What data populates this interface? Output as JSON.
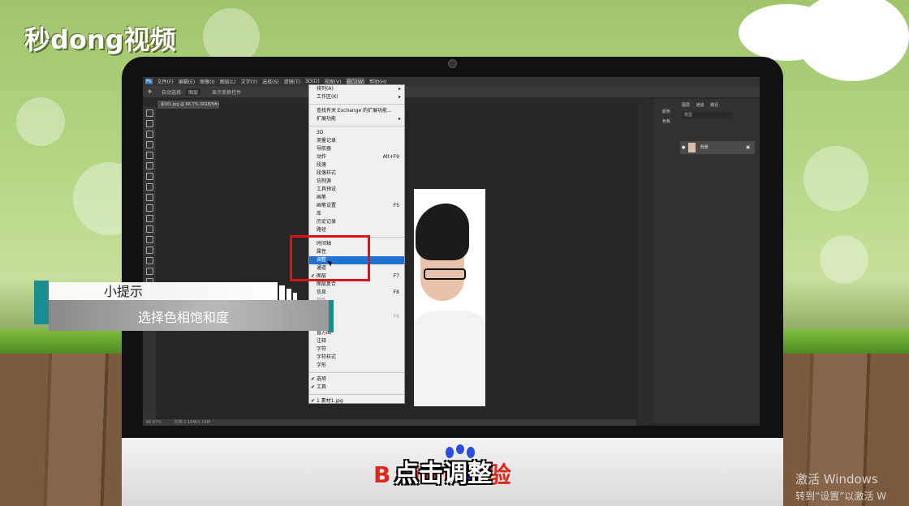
{
  "brand": {
    "logo_text": "秒dong视频"
  },
  "photoshop": {
    "menubar": [
      "文件(F)",
      "编辑(E)",
      "图像(I)",
      "图层(L)",
      "文字(Y)",
      "选择(S)",
      "滤镜(T)",
      "3D(D)",
      "视图(V)",
      "窗口(W)",
      "帮助(H)"
    ],
    "options": {
      "auto_select": "自动选择:",
      "auto_select_value": "图层",
      "transform": "显示变换控件"
    },
    "document_tab": "素材1.jpg @ 66.7% (RGB/8#)",
    "status": {
      "zoom": "66.67%",
      "doc_info": "文档:1.16M/1.16M"
    },
    "panels": {
      "side_labels": [
        "颜色",
        "色板"
      ],
      "tabs": [
        "图层",
        "通道",
        "路径"
      ],
      "search_placeholder": "类型",
      "layer_name": "背景"
    }
  },
  "window_menu": {
    "items": [
      {
        "label": "排列(A)",
        "arrow": true
      },
      {
        "label": "工作区(K)",
        "arrow": true
      },
      {
        "sep": true
      },
      {
        "label": "查找有关 Exchange 的扩展功能..."
      },
      {
        "label": "扩展功能",
        "arrow": true
      },
      {
        "sep": true
      },
      {
        "label": "3D"
      },
      {
        "label": "测量记录"
      },
      {
        "label": "导航器"
      },
      {
        "label": "动作",
        "shortcut": "Alt+F9"
      },
      {
        "label": "段落"
      },
      {
        "label": "段落样式"
      },
      {
        "label": "仿制源"
      },
      {
        "label": "工具预设"
      },
      {
        "label": "画笔"
      },
      {
        "label": "画笔设置",
        "shortcut": "F5"
      },
      {
        "label": "库"
      },
      {
        "label": "历史记录"
      },
      {
        "label": "路径"
      },
      {
        "sep": true
      },
      {
        "label": "时间轴"
      },
      {
        "label": "属性"
      },
      {
        "label": "调整",
        "selected": true
      },
      {
        "label": "通道"
      },
      {
        "label": "图层",
        "shortcut": "F7",
        "checked": true
      },
      {
        "label": "图层复合"
      },
      {
        "label": "信息",
        "shortcut": "F8"
      },
      {
        "label": "颜色",
        "dim": true
      },
      {
        "label": "样式",
        "dim": true
      },
      {
        "label": "直方图",
        "shortcut": "F6",
        "dim": true
      },
      {
        "label": "样式",
        "dim": true
      },
      {
        "label": "直方图"
      },
      {
        "label": "注释"
      },
      {
        "label": "字符"
      },
      {
        "label": "字符样式"
      },
      {
        "label": "字形"
      },
      {
        "sep": true
      },
      {
        "label": "选项",
        "checked": true
      },
      {
        "label": "工具",
        "checked": true
      },
      {
        "sep": true
      },
      {
        "label": "1 素材1.jpg",
        "checked": true
      }
    ]
  },
  "tip": {
    "title": "小提示",
    "text": "选择色相饱和度"
  },
  "caption": "点击调整",
  "watermark": "Baidu经验",
  "os_notice": {
    "line1": "激活 Windows",
    "line2": "转到“设置”以激活 W"
  },
  "colors": {
    "menu_highlight": "#1e73d2",
    "red_box": "#e0111a",
    "teal": "#1a8e8e"
  }
}
